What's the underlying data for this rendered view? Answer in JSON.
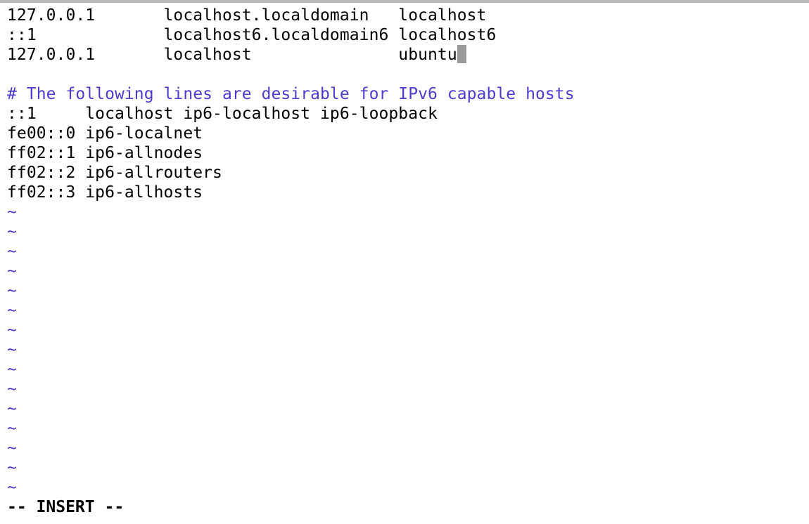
{
  "buffer": {
    "lines": [
      "127.0.0.1       localhost.localdomain   localhost",
      "::1             localhost6.localdomain6 localhost6",
      "127.0.0.1       localhost               ubuntu",
      "",
      "# The following lines are desirable for IPv6 capable hosts",
      "::1     localhost ip6-localhost ip6-loopback",
      "fe00::0 ip6-localnet",
      "ff02::1 ip6-allnodes",
      "ff02::2 ip6-allrouters",
      "ff02::3 ip6-allhosts"
    ],
    "tilde": "~"
  },
  "status": {
    "mode": "-- INSERT --"
  },
  "colors": {
    "comment": "#4b3ccf",
    "tilde": "#4b3ccf",
    "cursor": "#9a9a9a"
  }
}
